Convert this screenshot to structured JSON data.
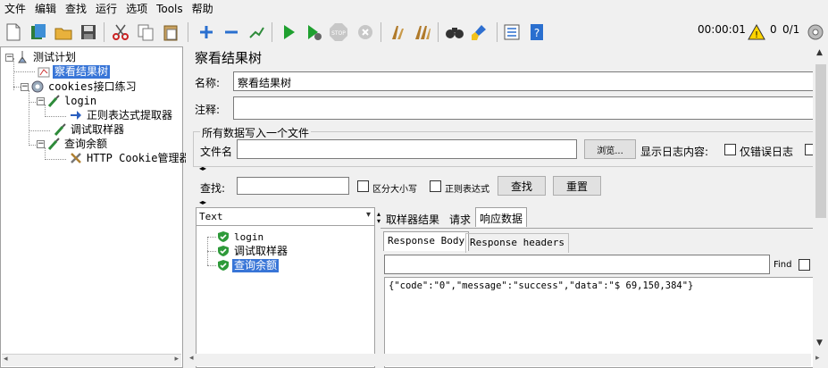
{
  "menu": [
    "文件",
    "编辑",
    "查找",
    "运行",
    "选项",
    "Tools",
    "帮助"
  ],
  "toolbar_status": {
    "timer": "00:00:01",
    "warnings": "0",
    "threads": "0/1"
  },
  "tree": {
    "items": [
      {
        "label": "测试计划"
      },
      {
        "label": "察看结果树"
      },
      {
        "label": "cookies接口练习"
      },
      {
        "label": "login"
      },
      {
        "label": "正则表达式提取器"
      },
      {
        "label": "调试取样器"
      },
      {
        "label": "查询余额"
      },
      {
        "label": "HTTP Cookie管理器"
      }
    ]
  },
  "panel": {
    "title": "察看结果树",
    "name_label": "名称:",
    "name_value": "察看结果树",
    "comment_label": "注释:",
    "comment_value": "",
    "file_group_title": "所有数据写入一个文件",
    "filename_label": "文件名",
    "filename_value": "",
    "browse_button": "浏览...",
    "log_label": "显示日志内容:",
    "errors_only_label": "仅错误日志",
    "search_label": "查找:",
    "search_value": "",
    "case_label": "区分大小写",
    "regex_label": "正则表达式",
    "find_button": "查找",
    "reset_button": "重置"
  },
  "results": {
    "renderer": "Text",
    "samples": [
      "login",
      "调试取样器",
      "查询余额"
    ],
    "tabs": [
      "取样器结果",
      "请求",
      "响应数据"
    ],
    "subtabs": [
      "Response Body",
      "Response headers"
    ],
    "find_label": "Find",
    "find_value": "",
    "body": "{\"code\":\"0\",\"message\":\"success\",\"data\":\"$ 69,150,384\"}"
  }
}
